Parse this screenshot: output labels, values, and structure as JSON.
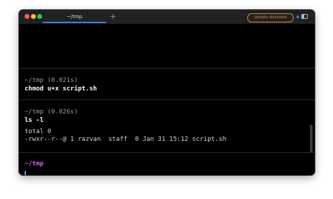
{
  "tabs": [
    {
      "label": "~/tmp",
      "active": true
    }
  ],
  "new_tab_label": "+",
  "update_button_label": "Update Available",
  "icons": {
    "close": "close-traffic-light-icon",
    "minimize": "minimize-traffic-light-icon",
    "maximize": "maximize-traffic-light-icon",
    "status": "status-dot-icon",
    "panel": "sidebar-panel-icon"
  },
  "colors": {
    "prompt": "#c76ad8",
    "accent": "#3c7be3",
    "update": "#d8892e",
    "cursor": "#4aa4e8"
  },
  "blocks": [
    {
      "dir_line": "~/tmp (0.021s)",
      "command": "chmod u+x script.sh",
      "output": []
    },
    {
      "dir_line": "~/tmp (0.026s)",
      "command": "ls -l",
      "output": [
        "total 0",
        "-rwxr--r--@ 1 razvan  staff  0 Jan 31 15:12 script.sh"
      ]
    }
  ],
  "active_prompt": "~/tmp"
}
